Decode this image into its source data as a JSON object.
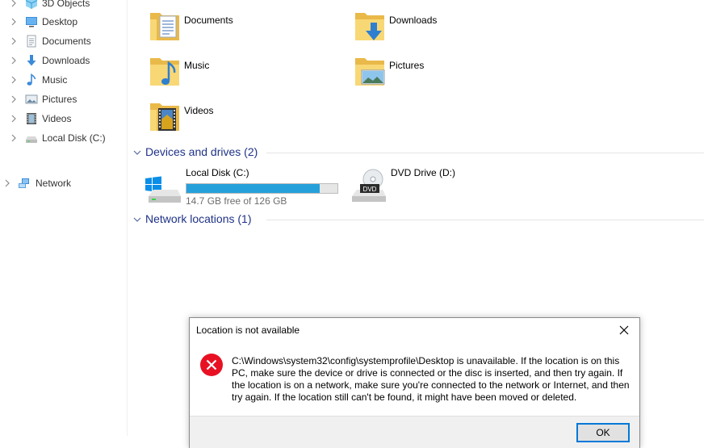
{
  "sidebar": {
    "items": [
      {
        "label": "3D Objects",
        "icon": "3d-objects-icon"
      },
      {
        "label": "Desktop",
        "icon": "desktop-icon"
      },
      {
        "label": "Documents",
        "icon": "documents-icon"
      },
      {
        "label": "Downloads",
        "icon": "downloads-icon"
      },
      {
        "label": "Music",
        "icon": "music-icon"
      },
      {
        "label": "Pictures",
        "icon": "pictures-icon"
      },
      {
        "label": "Videos",
        "icon": "videos-icon"
      },
      {
        "label": "Local Disk (C:)",
        "icon": "local-disk-icon"
      }
    ],
    "network": {
      "label": "Network",
      "icon": "network-icon"
    }
  },
  "folders": [
    {
      "label": "Documents",
      "icon": "documents-folder-icon"
    },
    {
      "label": "Downloads",
      "icon": "downloads-folder-icon"
    },
    {
      "label": "Music",
      "icon": "music-folder-icon"
    },
    {
      "label": "Pictures",
      "icon": "pictures-folder-icon"
    },
    {
      "label": "Videos",
      "icon": "videos-folder-icon"
    }
  ],
  "groups": {
    "devices": {
      "title": "Devices and drives (2)"
    },
    "network": {
      "title": "Network locations (1)"
    }
  },
  "drives": {
    "c": {
      "name": "Local Disk (C:)",
      "free": "14.7 GB free of 126 GB",
      "used_fraction": 0.883
    },
    "d": {
      "name": "DVD Drive (D:)",
      "badge": "DVD"
    }
  },
  "dialog": {
    "title": "Location is not available",
    "message": "C:\\Windows\\system32\\config\\systemprofile\\Desktop is unavailable. If the location is on this PC, make sure the device or drive is connected or the disc is inserted, and then try again. If the location is on a network, make sure you're connected to the network or Internet, and then try again. If the location still can't be found, it might have been moved or deleted.",
    "ok_label": "OK"
  },
  "colors": {
    "group_header": "#1e3287",
    "drive_bar": "#26a0da",
    "error": "#e81123",
    "folder": "#f8d775"
  }
}
